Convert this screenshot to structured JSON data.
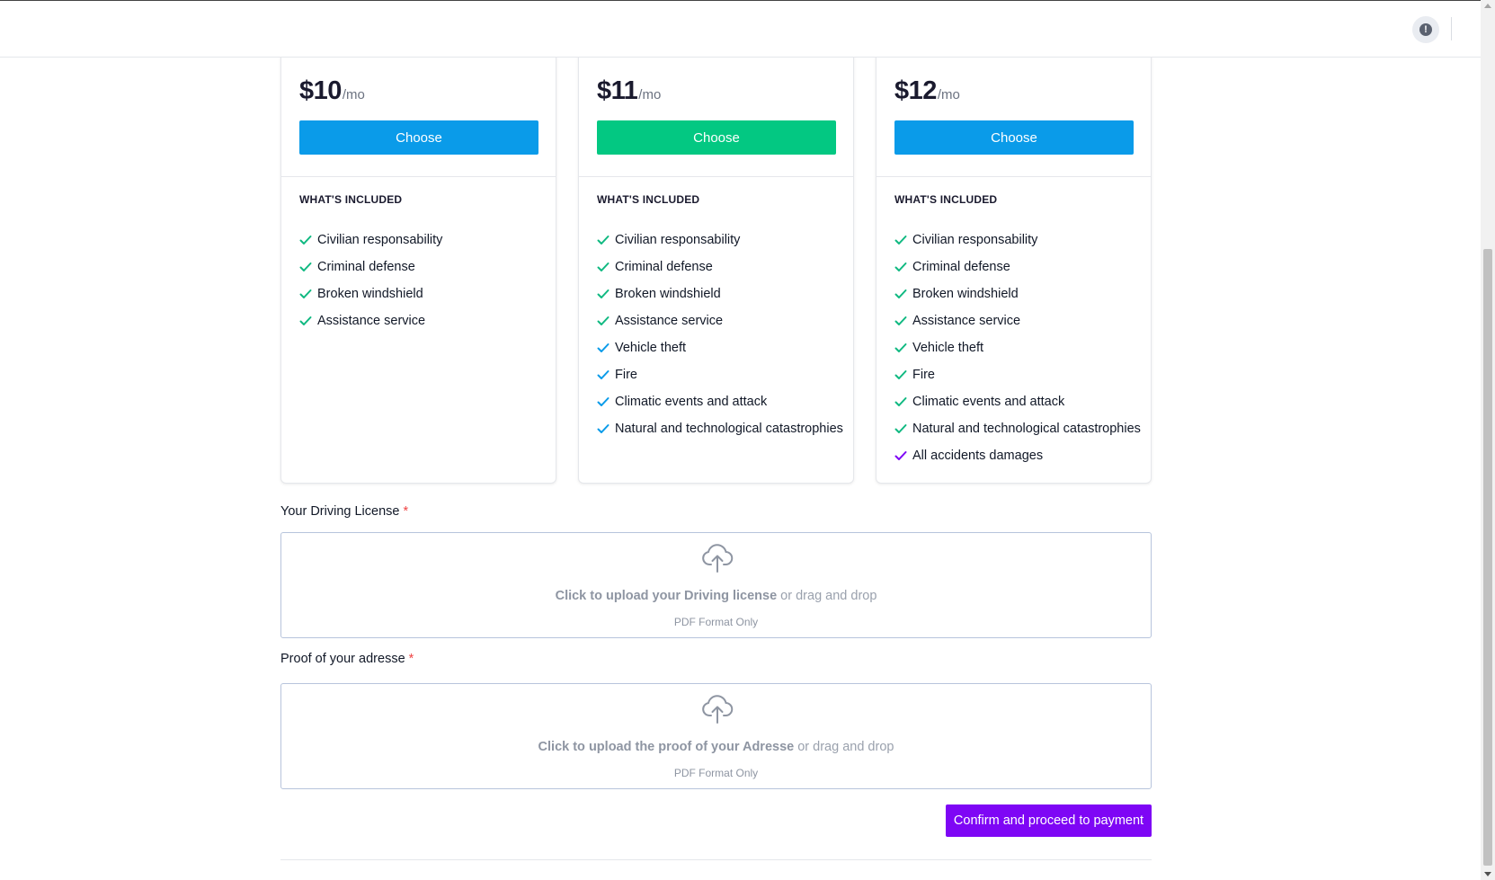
{
  "topbar": {
    "alert_icon_glyph": "!"
  },
  "colors": {
    "blue": "#0a9be9",
    "green": "#03c882",
    "purple": "#7e06f5",
    "check_green": "#10b981",
    "check_blue": "#0a9be9",
    "check_purple": "#7e06f5"
  },
  "plans": [
    {
      "amount": "$10",
      "per": "/mo",
      "choose_label": "Choose",
      "included_title": "WHAT'S INCLUDED",
      "features": [
        "Civilian responsability",
        "Criminal defense",
        "Broken windshield",
        "Assistance service"
      ]
    },
    {
      "amount": "$11",
      "per": "/mo",
      "choose_label": "Choose",
      "included_title": "WHAT'S INCLUDED",
      "features": [
        "Civilian responsability",
        "Criminal defense",
        "Broken windshield",
        "Assistance service",
        "Vehicle theft",
        "Fire",
        "Climatic events and attack",
        "Natural and technological catastrophies"
      ]
    },
    {
      "amount": "$12",
      "per": "/mo",
      "choose_label": "Choose",
      "included_title": "WHAT'S INCLUDED",
      "features": [
        "Civilian responsability",
        "Criminal defense",
        "Broken windshield",
        "Assistance service",
        "Vehicle theft",
        "Fire",
        "Climatic events and attack",
        "Natural and technological catastrophies",
        "All accidents damages"
      ]
    }
  ],
  "license": {
    "label": "Your Driving License",
    "required_mark": "*",
    "upload_strong": "Click to upload your Driving license",
    "upload_rest": " or drag and drop",
    "format": "PDF Format Only"
  },
  "address": {
    "label": "Proof of your adresse",
    "required_mark": "*",
    "upload_strong": "Click to upload the proof of your Adresse",
    "upload_rest": " or drag and drop",
    "format": "PDF Format Only"
  },
  "confirm_label": "Confirm and proceed to payment"
}
